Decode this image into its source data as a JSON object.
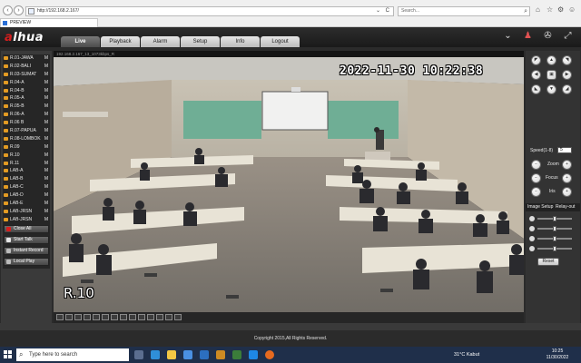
{
  "browser": {
    "url": "http://192.168.2.167/",
    "search_placeholder": "Search...",
    "tab_title": "PREVIEW",
    "address_controls": "⌄ C",
    "toolbar_icons": [
      "home-icon",
      "star-icon",
      "gear-icon",
      "smiley-icon"
    ]
  },
  "app": {
    "logo_prefix": "a",
    "logo_text": "lhua",
    "menu": [
      {
        "label": "Live",
        "active": true
      },
      {
        "label": "Playback",
        "active": false
      },
      {
        "label": "Alarm",
        "active": false
      },
      {
        "label": "Setup",
        "active": false
      },
      {
        "label": "Info",
        "active": false
      },
      {
        "label": "Logout",
        "active": false
      }
    ],
    "header_icons": [
      "chevron-down-icon",
      "user-icon",
      "camera-icon",
      "fullscreen-icon"
    ]
  },
  "cameras": [
    {
      "name": "R.01-JAWA",
      "flag": "M"
    },
    {
      "name": "R.02-BALI",
      "flag": "M"
    },
    {
      "name": "R.03-SUMAT",
      "flag": "M"
    },
    {
      "name": "R.04-A",
      "flag": "M"
    },
    {
      "name": "R.04-B",
      "flag": "M"
    },
    {
      "name": "R.05-A",
      "flag": "M"
    },
    {
      "name": "R.05-B",
      "flag": "M"
    },
    {
      "name": "R.06-A",
      "flag": "M"
    },
    {
      "name": "R.06 B",
      "flag": "M"
    },
    {
      "name": "R.07-PAPUA",
      "flag": "M"
    },
    {
      "name": "R.08-LOMBOK",
      "flag": "M"
    },
    {
      "name": "R.09",
      "flag": "M"
    },
    {
      "name": "R.10",
      "flag": "M"
    },
    {
      "name": "R.11",
      "flag": "M"
    },
    {
      "name": "LAB-A",
      "flag": "M"
    },
    {
      "name": "LAB-B",
      "flag": "M"
    },
    {
      "name": "LAB-C",
      "flag": "M"
    },
    {
      "name": "LAB-D",
      "flag": "M"
    },
    {
      "name": "LAB-E",
      "flag": "M"
    },
    {
      "name": "LAB-JRSN",
      "flag": "M"
    },
    {
      "name": "LAB-JRSN",
      "flag": "M"
    }
  ],
  "controls": {
    "close_all": "Close All",
    "start_talk": "Start Talk",
    "instant_record": "Instant Record",
    "local_play": "Local Play"
  },
  "video": {
    "stream_info": "192.168.2.167_13_1073kbps_R",
    "timestamp": "2022-11-30 10:22:38",
    "camera_name": "R.10"
  },
  "ptz": {
    "speed_label": "Speed(1-8)",
    "speed_value": "5",
    "zoom_label": "Zoom",
    "focus_label": "Focus",
    "iris_label": "Iris",
    "image_setup": "Image Setup",
    "relay_out": "Relay-out",
    "reset": "Reset",
    "brightness": 0.5,
    "contrast": 0.5,
    "saturation": 0.5,
    "hue": 0.5
  },
  "footer": {
    "copyright": "Copyright 2015,All Rights Reserved."
  },
  "taskbar": {
    "search_placeholder": "Type here to search",
    "weather": "31°C  Kabut",
    "time": "10:25",
    "date": "11/30/2022",
    "apps": [
      "task-view-icon",
      "edge-icon",
      "file-explorer-icon",
      "store-icon",
      "mail-icon",
      "chrome-icon",
      "app-icon",
      "ie-icon",
      "firefox-icon"
    ]
  },
  "colors": {
    "accent_red": "#d51e1e",
    "camera_icon": "#e39b23",
    "panel_dark": "#262626",
    "active_menu": "#5a5a5a"
  }
}
